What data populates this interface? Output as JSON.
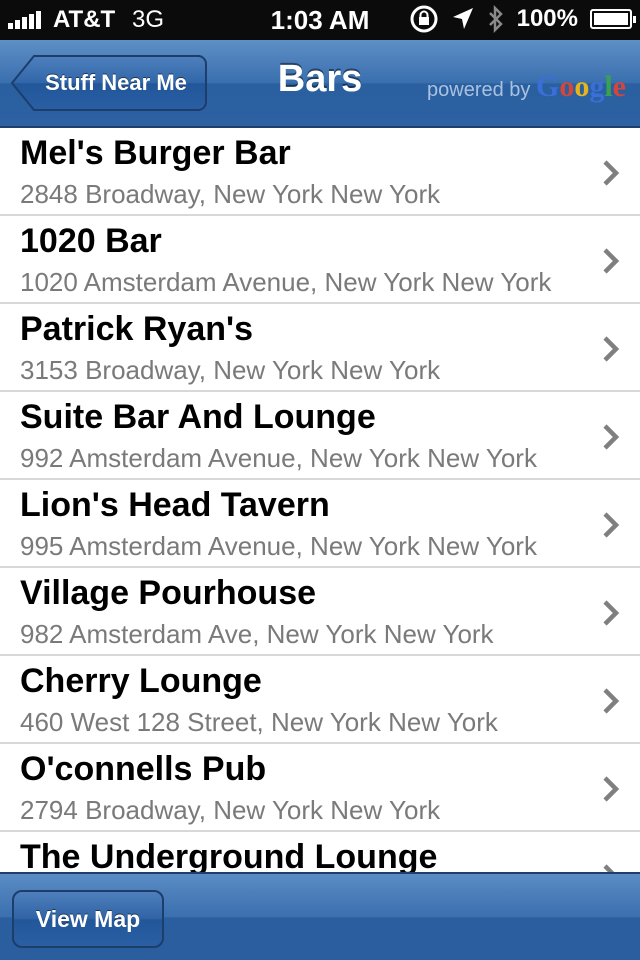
{
  "status_bar": {
    "carrier": "AT&T",
    "network": "3G",
    "time": "1:03 AM",
    "battery": "100%",
    "icons": [
      "signal-bars-icon",
      "rotation-lock-icon",
      "location-arrow-icon",
      "bluetooth-icon",
      "battery-icon"
    ]
  },
  "nav": {
    "back_label": "Stuff Near Me",
    "title": "Bars",
    "powered_by": "powered by",
    "brand": "Google"
  },
  "places": [
    {
      "name": "Mel's Burger Bar",
      "address": "2848 Broadway, New York New York"
    },
    {
      "name": "1020 Bar",
      "address": "1020 Amsterdam Avenue, New York New York"
    },
    {
      "name": "Patrick Ryan's",
      "address": "3153 Broadway, New York New York"
    },
    {
      "name": "Suite Bar And Lounge",
      "address": "992 Amsterdam Avenue, New York New York"
    },
    {
      "name": "Lion's Head Tavern",
      "address": "995 Amsterdam Avenue, New York New York"
    },
    {
      "name": "Village Pourhouse",
      "address": "982 Amsterdam Ave, New York New York"
    },
    {
      "name": "Cherry Lounge",
      "address": "460 West 128 Street, New York New York"
    },
    {
      "name": "O'connells Pub",
      "address": "2794 Broadway, New York New York"
    },
    {
      "name": "The Underground Lounge",
      "address": ""
    }
  ],
  "toolbar": {
    "view_map_label": "View Map"
  },
  "colors": {
    "nav_blue": "#2c61a2",
    "address_gray": "#7a7a7a",
    "chevron_gray": "#7f7f7f"
  }
}
